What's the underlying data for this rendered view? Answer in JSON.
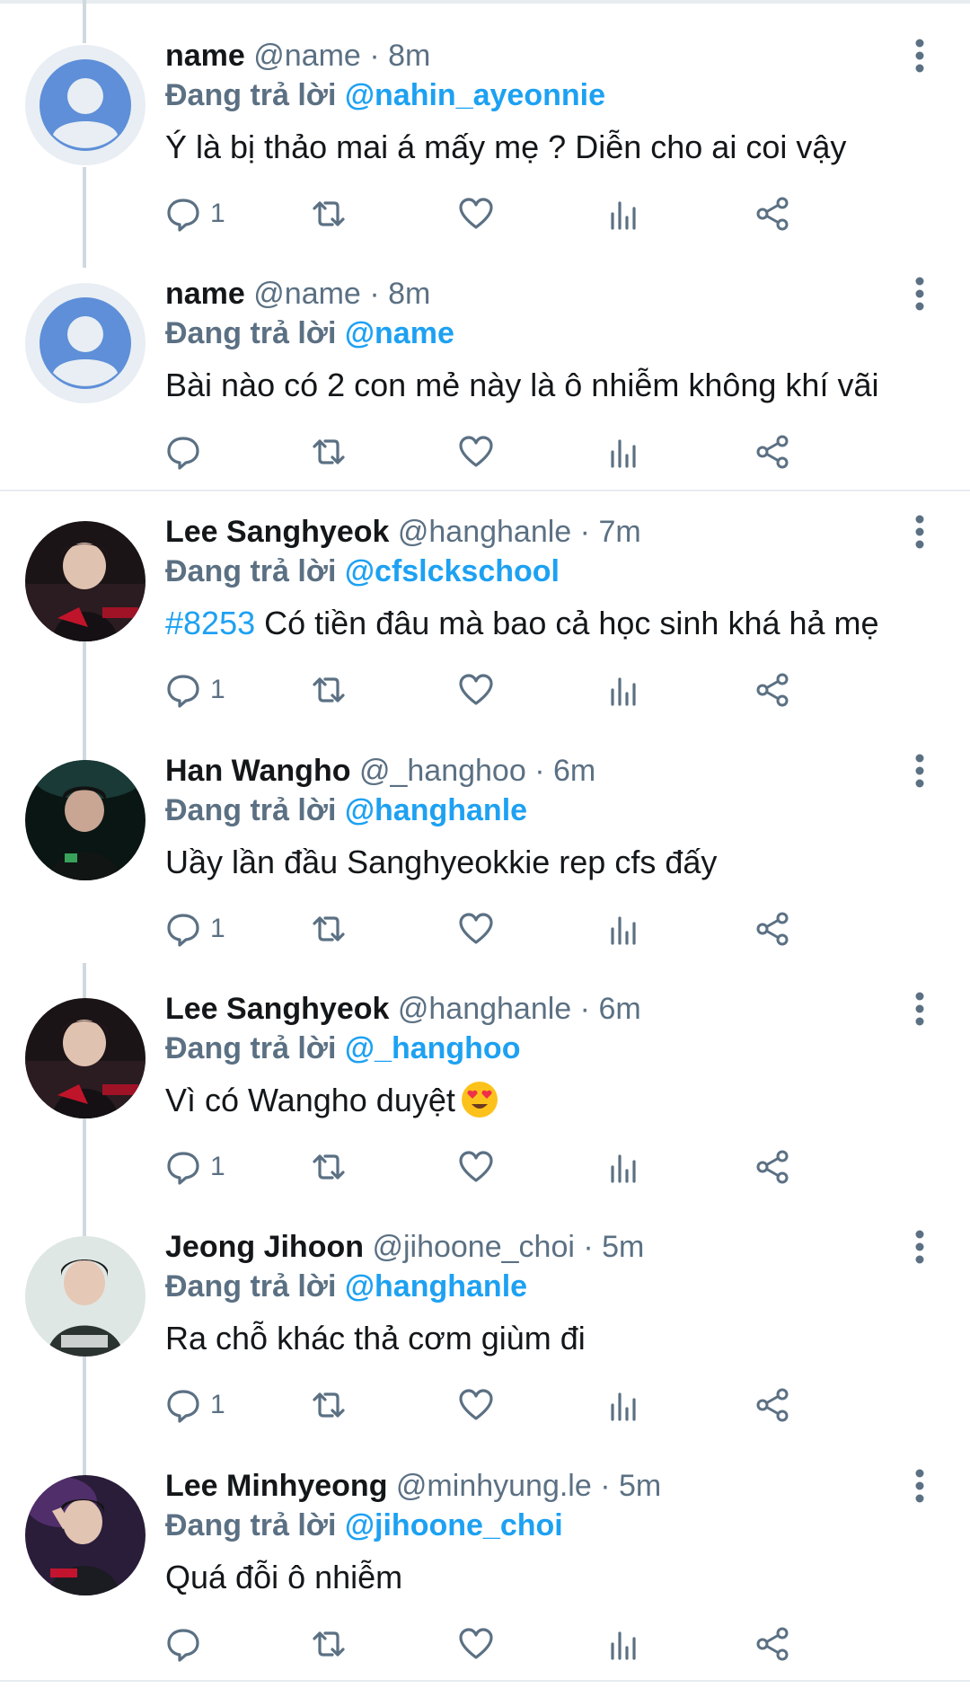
{
  "tweets": [
    {
      "display_name": "name",
      "handle": "@name",
      "time": "8m",
      "reply_label": "Đang trả lời",
      "reply_to": "@nahin_ayeonnie",
      "text": "Ý là bị thảo mai á mấy mẹ ? Diễn cho ai coi vậy",
      "reply_count": "1",
      "avatar": "default-avatar"
    },
    {
      "display_name": "name",
      "handle": "@name",
      "time": "8m",
      "reply_label": "Đang trả lời",
      "reply_to": "@name",
      "text": "Bài nào có 2 con mẻ này là ô nhiễm không khí vãi",
      "reply_count": "",
      "avatar": "default-avatar"
    },
    {
      "display_name": "Lee Sanghyeok",
      "handle": "@hanghanle",
      "time": "7m",
      "reply_label": "Đang trả lời",
      "reply_to": "@cfslckschool",
      "hashtag": "#8253",
      "text": "Có tiền đâu mà bao cả học sinh khá hả mẹ",
      "reply_count": "1",
      "avatar": "photo-avatar"
    },
    {
      "display_name": "Han Wangho",
      "handle": "@_hanghoo",
      "time": "6m",
      "reply_label": "Đang trả lời",
      "reply_to": "@hanghanle",
      "text": "Uầy lần đầu Sanghyeokkie rep cfs đấy",
      "reply_count": "1",
      "avatar": "photo-avatar"
    },
    {
      "display_name": "Lee Sanghyeok",
      "handle": "@hanghanle",
      "time": "6m",
      "reply_label": "Đang trả lời",
      "reply_to": "@_hanghoo",
      "text": "Vì có Wangho duyệt",
      "emoji": "heart-eyes-emoji",
      "reply_count": "1",
      "avatar": "photo-avatar"
    },
    {
      "display_name": "Jeong Jihoon",
      "handle": "@jihoone_choi",
      "time": "5m",
      "reply_label": "Đang trả lời",
      "reply_to": "@hanghanle",
      "text": "Ra chỗ khác thả cơm giùm đi",
      "reply_count": "1",
      "avatar": "photo-avatar"
    },
    {
      "display_name": "Lee Minhyeong",
      "handle": "@minhyung.le",
      "time": "5m",
      "reply_label": "Đang trả lời",
      "reply_to": "@jihoone_choi",
      "text": "Quá đỗi ô nhiễm",
      "reply_count": "",
      "avatar": "photo-avatar"
    }
  ],
  "separator": "·",
  "colors": {
    "link": "#1da1f2",
    "muted": "#5b7083",
    "text": "#14171a",
    "divider": "#e6ecf0"
  },
  "icons": [
    "reply-icon",
    "retweet-icon",
    "like-icon",
    "analytics-icon",
    "share-icon",
    "more-icon"
  ]
}
